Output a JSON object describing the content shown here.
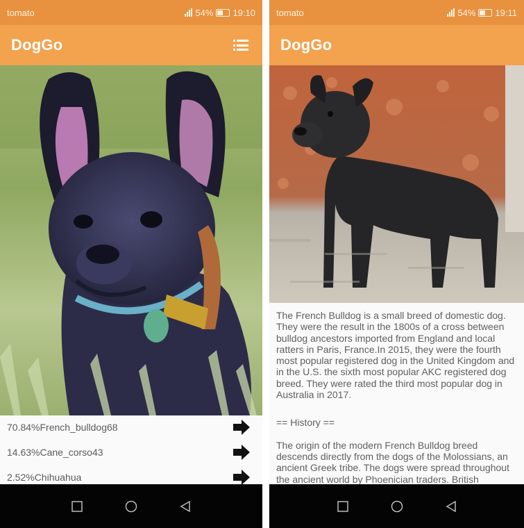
{
  "left": {
    "status": {
      "carrier": "tomato",
      "battery": "54%",
      "time": "19:10"
    },
    "app_title": "DogGo",
    "menu_icon": "list-menu-icon",
    "photo": {
      "subject": "french-bulldog-closeup"
    },
    "results": [
      {
        "label": "70.84%French_bulldog68"
      },
      {
        "label": "14.63%Cane_corso43"
      },
      {
        "label": "2.52%Chihuahua"
      }
    ],
    "navbar": [
      "square-icon",
      "circle-icon",
      "triangle-back-icon"
    ]
  },
  "right": {
    "status": {
      "carrier": "tomato",
      "battery": "54%",
      "time": "19:11"
    },
    "app_title": "DogGo",
    "photo": {
      "subject": "french-bulldog-standing"
    },
    "description": "The French Bulldog is a small breed of domestic dog. They were the result in the 1800s of a cross between bulldog ancestors imported from England and local ratters in Paris, France.In 2015, they were the fourth most popular registered dog in the United Kingdom and in the U.S. the sixth most popular AKC registered dog breed. They were rated the third most popular dog in Australia in 2017.",
    "history_heading": "== History ==",
    "history_text": "The origin of the modern French Bulldog breed descends directly from the dogs of the Molossians, an ancient Greek tribe. The dogs were spread throughout the ancient world by Phoenician traders. British",
    "navbar": [
      "square-icon",
      "circle-icon",
      "triangle-back-icon"
    ]
  },
  "colors": {
    "status_bar": "#e8913f",
    "app_bar": "#f3a24e",
    "text": "#5f5f5f",
    "nav_bar": "#040404"
  }
}
